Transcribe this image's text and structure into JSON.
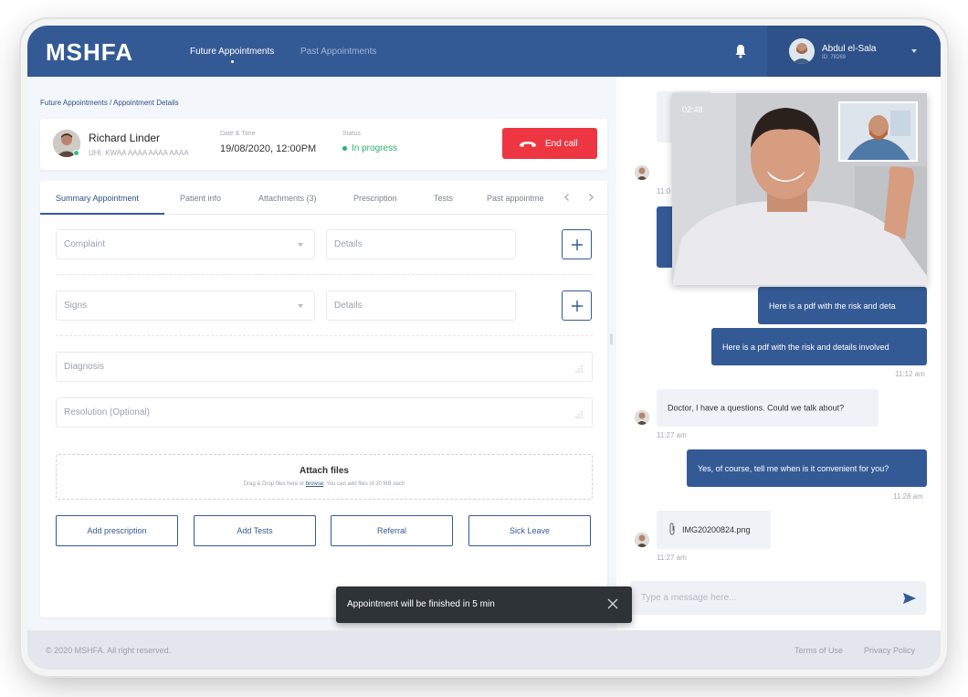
{
  "header": {
    "logo": "MSHFA",
    "nav": [
      "Future Appointments",
      "Past Appointments"
    ],
    "user": {
      "name": "Abdul el-Sala",
      "id": "ID: 78269"
    }
  },
  "breadcrumb": "Future Appointments / Appointment Details",
  "patient": {
    "name": "Richard Linder",
    "uhi": "UHI: KWAA AAAA AAAA AAAA",
    "datetime_label": "Date & Time",
    "datetime": "19/08/2020, 12:00PM",
    "status_label": "Status",
    "status": "In progress",
    "end_call": "End call"
  },
  "tabs": [
    "Summary Appointment",
    "Patient info",
    "Attachments (3)",
    "Prescription",
    "Tests",
    "Past appointme"
  ],
  "form": {
    "complaint_placeholder": "Complaint",
    "details_placeholder": "Details",
    "signs_placeholder": "Signs",
    "details2_placeholder": "Details",
    "diagnosis_placeholder": "Diagnosis",
    "resolution_placeholder": "Resolution (Optional)",
    "attach_title": "Attach files",
    "attach_sub_before": "Drag & Drop files here or ",
    "attach_link": "browse",
    "attach_sub_after": ". You can add files of 20 MB each",
    "buttons": [
      "Add prescription",
      "Add Tests",
      "Referral",
      "Sick Leave"
    ]
  },
  "video": {
    "timer": "02:48"
  },
  "chat": {
    "messages": [
      {
        "text": "Here is a pdf with the risk and deta"
      },
      {
        "text": "Here is a pdf with the risk and details involved",
        "time": "11:12 am"
      },
      {
        "text": "Doctor, I have a questions. Could we talk about?",
        "time": "11:27 am"
      },
      {
        "text": "Yes, of course, tell me when is it convenient for you?",
        "time": "11:28 am"
      },
      {
        "text": "IMG20200824.png",
        "time": "11:27 am"
      }
    ],
    "partial_times": [
      "11:0"
    ],
    "input_placeholder": "Type a message here..."
  },
  "toast": "Appointment will be finished in 5 min",
  "footer": {
    "copyright": "© 2020 MSHFA. All right reserved.",
    "links": [
      "Terms of Use",
      "Privacy Policy"
    ]
  },
  "colors": {
    "primary": "#345a96",
    "danger": "#ee3642",
    "success": "#27b36b",
    "toast": "#2e3338"
  }
}
